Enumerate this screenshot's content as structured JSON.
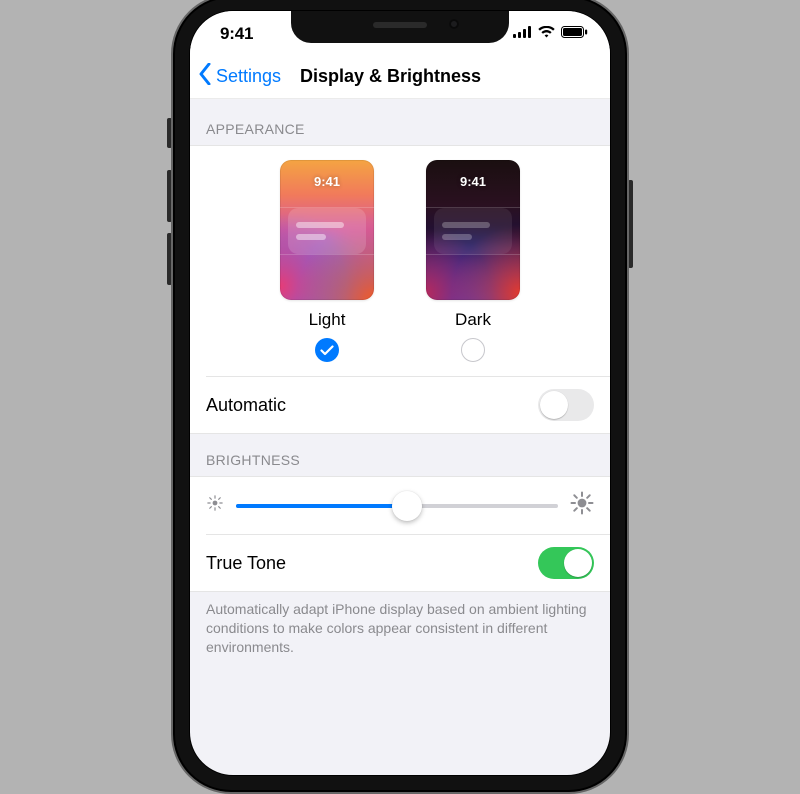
{
  "status": {
    "time": "9:41",
    "cell_bars": 4,
    "wifi_on": true,
    "battery_level": 100
  },
  "nav": {
    "back_label": "Settings",
    "title": "Display & Brightness"
  },
  "appearance": {
    "header_label": "APPEARANCE",
    "preview_time": "9:41",
    "options": {
      "light_label": "Light",
      "dark_label": "Dark",
      "selected": "light"
    },
    "automatic": {
      "label": "Automatic",
      "value": false
    }
  },
  "brightness": {
    "header_label": "BRIGHTNESS",
    "value_percent": 53,
    "true_tone": {
      "label": "True Tone",
      "value": true
    },
    "description": "Automatically adapt iPhone display based on ambient lighting conditions to make colors appear consistent in different environments."
  },
  "colors": {
    "ios_blue": "#007aff",
    "ios_green": "#34c759",
    "ios_gray_bg": "#f2f2f7",
    "ios_separator": "rgba(0,0,0,0.1)",
    "ios_secondary_text": "#8a8a8e",
    "switch_off_bg": "#e9e9ea",
    "slider_track": "#d1d1d6"
  },
  "icons": {
    "back_chevron": "chevron-left-icon",
    "checkmark": "checkmark-icon",
    "cellular": "cellular-bars-icon",
    "wifi": "wifi-icon",
    "battery": "battery-icon",
    "sun_small": "sun-small-icon",
    "sun_large": "sun-large-icon"
  }
}
